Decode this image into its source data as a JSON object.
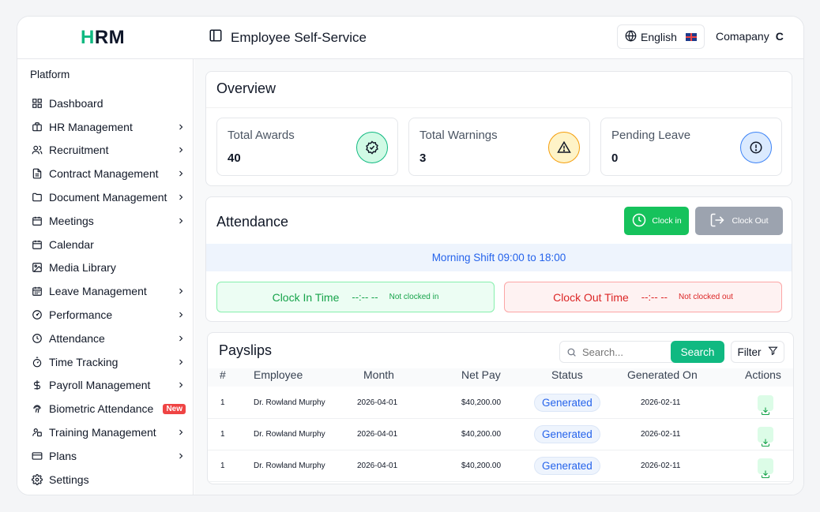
{
  "app": {
    "logo_text": "HRM",
    "page_title": "Employee Self-Service"
  },
  "header": {
    "language_label": "English",
    "company_label": "Comapany",
    "company_avatar": "C"
  },
  "sidebar": {
    "heading": "Platform",
    "items": [
      {
        "label": "Dashboard",
        "icon": "grid-icon",
        "chevron": false
      },
      {
        "label": "HR Management",
        "icon": "briefcase-icon",
        "chevron": true
      },
      {
        "label": "Recruitment",
        "icon": "users-icon",
        "chevron": true
      },
      {
        "label": "Contract Management",
        "icon": "file-text-icon",
        "chevron": true
      },
      {
        "label": "Document Management",
        "icon": "folder-icon",
        "chevron": true
      },
      {
        "label": "Meetings",
        "icon": "calendar-icon",
        "chevron": true
      },
      {
        "label": "Calendar",
        "icon": "calendar-icon",
        "chevron": false
      },
      {
        "label": "Media Library",
        "icon": "image-icon",
        "chevron": false
      },
      {
        "label": "Leave Management",
        "icon": "calendar-days-icon",
        "chevron": true
      },
      {
        "label": "Performance",
        "icon": "gauge-icon",
        "chevron": true
      },
      {
        "label": "Attendance",
        "icon": "clock-icon",
        "chevron": true
      },
      {
        "label": "Time Tracking",
        "icon": "timer-icon",
        "chevron": true
      },
      {
        "label": "Payroll Management",
        "icon": "dollar-icon",
        "chevron": true
      },
      {
        "label": "Biometric Attendance",
        "icon": "fingerprint-icon",
        "chevron": false,
        "badge": "New"
      },
      {
        "label": "Training Management",
        "icon": "training-icon",
        "chevron": true
      },
      {
        "label": "Plans",
        "icon": "credit-card-icon",
        "chevron": true
      },
      {
        "label": "Settings",
        "icon": "gear-icon",
        "chevron": false
      }
    ]
  },
  "overview": {
    "title": "Overview",
    "stats": [
      {
        "label": "Total Awards",
        "value": "40",
        "icon": "badge-check-icon",
        "color": "#d1fae5",
        "border": "#10b981"
      },
      {
        "label": "Total Warnings",
        "value": "3",
        "icon": "warning-icon",
        "color": "#fef3c7",
        "border": "#f59e0b"
      },
      {
        "label": "Pending Leave",
        "value": "0",
        "icon": "alert-circle-icon",
        "color": "#dbeafe",
        "border": "#3b82f6"
      }
    ]
  },
  "attendance": {
    "title": "Attendance",
    "clock_in_button": "Clock in",
    "clock_out_button": "Clock Out",
    "shift": "Morning Shift 09:00 to 18:00",
    "clock_in": {
      "label": "Clock In Time",
      "value": "--:-- --",
      "status": "Not clocked in"
    },
    "clock_out": {
      "label": "Clock Out Time",
      "value": "--:-- --",
      "status": "Not clocked out"
    }
  },
  "payslips": {
    "title": "Payslips",
    "search_placeholder": "Search...",
    "search_button": "Search",
    "filter_button": "Filter",
    "columns": [
      "#",
      "Employee",
      "Month",
      "Net Pay",
      "Status",
      "Generated On",
      "Actions"
    ],
    "rows": [
      {
        "num": "1",
        "employee": "Dr. Rowland Murphy",
        "month": "2026-04-01",
        "net_pay": "$40,200.00",
        "status": "Generated",
        "generated_on": "2026-02-11"
      },
      {
        "num": "1",
        "employee": "Dr. Rowland Murphy",
        "month": "2026-04-01",
        "net_pay": "$40,200.00",
        "status": "Generated",
        "generated_on": "2026-02-11"
      },
      {
        "num": "1",
        "employee": "Dr. Rowland Murphy",
        "month": "2026-04-01",
        "net_pay": "$40,200.00",
        "status": "Generated",
        "generated_on": "2026-02-11"
      }
    ]
  },
  "colors": {
    "accent": "#10b981",
    "clock_in": "#16c25c",
    "clock_out": "#9ca3af",
    "shift_text": "#2563eb"
  }
}
